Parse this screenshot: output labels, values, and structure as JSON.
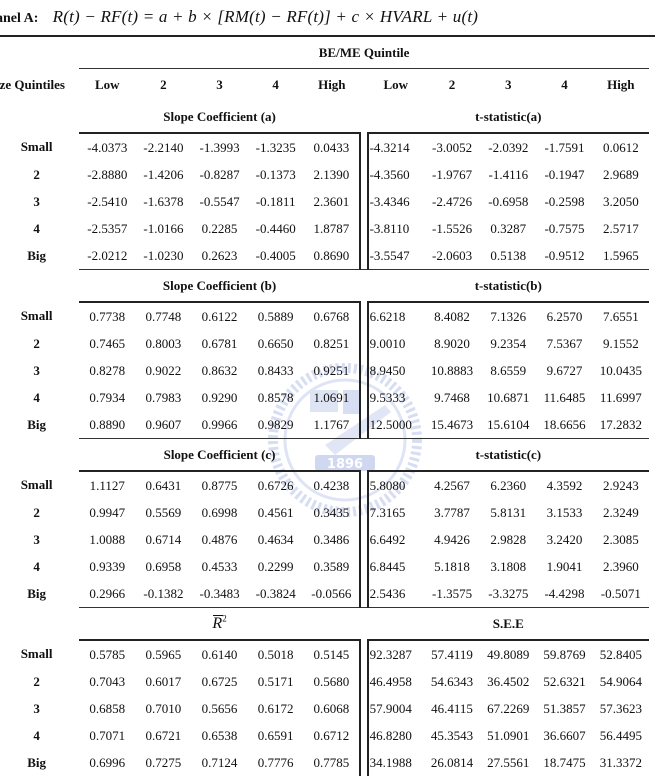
{
  "panel": {
    "label": "anel A:",
    "equation": "R(t) − RF(t) = a + b × [RM(t) − RF(t)] + c × HVARL + u(t)"
  },
  "header": {
    "group_label": "BE/ME Quintile",
    "row_header": "ize Quintiles",
    "columns": [
      "Low",
      "2",
      "3",
      "4",
      "High"
    ]
  },
  "row_labels": [
    "Small",
    "2",
    "3",
    "4",
    "Big"
  ],
  "sections": [
    {
      "left_title": "Slope Coefficient (a)",
      "right_title": "t-statistic(a)",
      "left": [
        [
          "-4.0373",
          "-2.2140",
          "-1.3993",
          "-1.3235",
          "0.0433"
        ],
        [
          "-2.8880",
          "-1.4206",
          "-0.8287",
          "-0.1373",
          "2.1390"
        ],
        [
          "-2.5410",
          "-1.6378",
          "-0.5547",
          "-0.1811",
          "2.3601"
        ],
        [
          "-2.5357",
          "-1.0166",
          "0.2285",
          "-0.4460",
          "1.8787"
        ],
        [
          "-2.0212",
          "-1.0230",
          "0.2623",
          "-0.4005",
          "0.8690"
        ]
      ],
      "right": [
        [
          "-4.3214",
          "-3.0052",
          "-2.0392",
          "-1.7591",
          "0.0612"
        ],
        [
          "-4.3560",
          "-1.9767",
          "-1.4116",
          "-0.1947",
          "2.9689"
        ],
        [
          "-3.4346",
          "-2.4726",
          "-0.6958",
          "-0.2598",
          "3.2050"
        ],
        [
          "-3.8110",
          "-1.5526",
          "0.3287",
          "-0.7575",
          "2.5717"
        ],
        [
          "-3.5547",
          "-2.0603",
          "0.5138",
          "-0.9512",
          "1.5965"
        ]
      ]
    },
    {
      "left_title": "Slope Coefficient (b)",
      "right_title": "t-statistic(b)",
      "left": [
        [
          "0.7738",
          "0.7748",
          "0.6122",
          "0.5889",
          "0.6768"
        ],
        [
          "0.7465",
          "0.8003",
          "0.6781",
          "0.6650",
          "0.8251"
        ],
        [
          "0.8278",
          "0.9022",
          "0.8632",
          "0.8433",
          "0.9251"
        ],
        [
          "0.7934",
          "0.7983",
          "0.9290",
          "0.8578",
          "1.0691"
        ],
        [
          "0.8890",
          "0.9607",
          "0.9966",
          "0.9829",
          "1.1767"
        ]
      ],
      "right": [
        [
          "6.6218",
          "8.4082",
          "7.1326",
          "6.2570",
          "7.6551"
        ],
        [
          "9.0010",
          "8.9020",
          "9.2354",
          "7.5367",
          "9.1552"
        ],
        [
          "8.9450",
          "10.8883",
          "8.6559",
          "9.6727",
          "10.0435"
        ],
        [
          "9.5333",
          "9.7468",
          "10.6871",
          "11.6485",
          "11.6997"
        ],
        [
          "12.5000",
          "15.4673",
          "15.6104",
          "18.6656",
          "17.2832"
        ]
      ]
    },
    {
      "left_title": "Slope Coefficient (c)",
      "right_title": "t-statistic(c)",
      "left": [
        [
          "1.1127",
          "0.6431",
          "0.8775",
          "0.6726",
          "0.4238"
        ],
        [
          "0.9947",
          "0.5569",
          "0.6998",
          "0.4561",
          "0.3435"
        ],
        [
          "1.0088",
          "0.6714",
          "0.4876",
          "0.4634",
          "0.3486"
        ],
        [
          "0.9339",
          "0.6958",
          "0.4533",
          "0.2299",
          "0.3589"
        ],
        [
          "0.2966",
          "-0.1382",
          "-0.3483",
          "-0.3824",
          "-0.0566"
        ]
      ],
      "right": [
        [
          "5.8080",
          "4.2567",
          "6.2360",
          "4.3592",
          "2.9243"
        ],
        [
          "7.3165",
          "3.7787",
          "5.8131",
          "3.1533",
          "2.3249"
        ],
        [
          "6.6492",
          "4.9426",
          "2.9828",
          "3.2420",
          "2.3085"
        ],
        [
          "6.8445",
          "5.1818",
          "3.1808",
          "1.9041",
          "2.3960"
        ],
        [
          "2.5436",
          "-1.3575",
          "-3.3275",
          "-4.4298",
          "-0.5071"
        ]
      ]
    },
    {
      "left_title": "R̄²",
      "right_title": "S.E.E",
      "left": [
        [
          "0.5785",
          "0.5965",
          "0.6140",
          "0.5018",
          "0.5145"
        ],
        [
          "0.7043",
          "0.6017",
          "0.6725",
          "0.5171",
          "0.5680"
        ],
        [
          "0.6858",
          "0.7010",
          "0.5656",
          "0.6172",
          "0.6068"
        ],
        [
          "0.7071",
          "0.6721",
          "0.6538",
          "0.6591",
          "0.6712"
        ],
        [
          "0.6996",
          "0.7275",
          "0.7124",
          "0.7776",
          "0.7785"
        ]
      ],
      "right": [
        [
          "92.3287",
          "57.4119",
          "49.8089",
          "59.8769",
          "52.8405"
        ],
        [
          "46.4958",
          "54.6343",
          "36.4502",
          "52.6321",
          "54.9064"
        ],
        [
          "57.9004",
          "46.4115",
          "67.2269",
          "51.3857",
          "57.3623"
        ],
        [
          "46.8280",
          "45.3543",
          "51.0901",
          "36.6607",
          "56.4495"
        ],
        [
          "34.1988",
          "26.0814",
          "27.5561",
          "18.7475",
          "31.3372"
        ]
      ]
    }
  ],
  "watermark": {
    "text": "1896",
    "color": "#9fb0e0"
  }
}
